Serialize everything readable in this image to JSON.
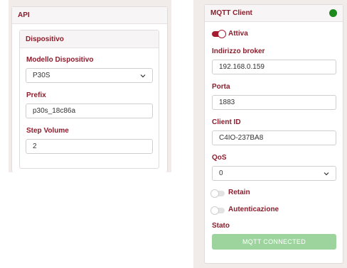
{
  "api_panel": {
    "title": "API",
    "device_section": {
      "title": "Dispositivo",
      "model_label": "Modello Dispositivo",
      "model_value": "P30S",
      "prefix_label": "Prefix",
      "prefix_value": "p30s_18c86a",
      "step_volume_label": "Step Volume",
      "step_volume_value": "2"
    }
  },
  "mqtt_panel": {
    "title": "MQTT Client",
    "status_color": "#1d8a1d",
    "active_label": "Attiva",
    "active_on": true,
    "broker_label": "Indirizzo broker",
    "broker_value": "192.168.0.159",
    "port_label": "Porta",
    "port_value": "1883",
    "client_id_label": "Client ID",
    "client_id_value": "C4IO-237BA8",
    "qos_label": "QoS",
    "qos_value": "0",
    "retain_label": "Retain",
    "retain_on": false,
    "auth_label": "Autenticazione",
    "auth_on": false,
    "status_label": "Stato",
    "status_button": "MQTT CONNECTED"
  }
}
